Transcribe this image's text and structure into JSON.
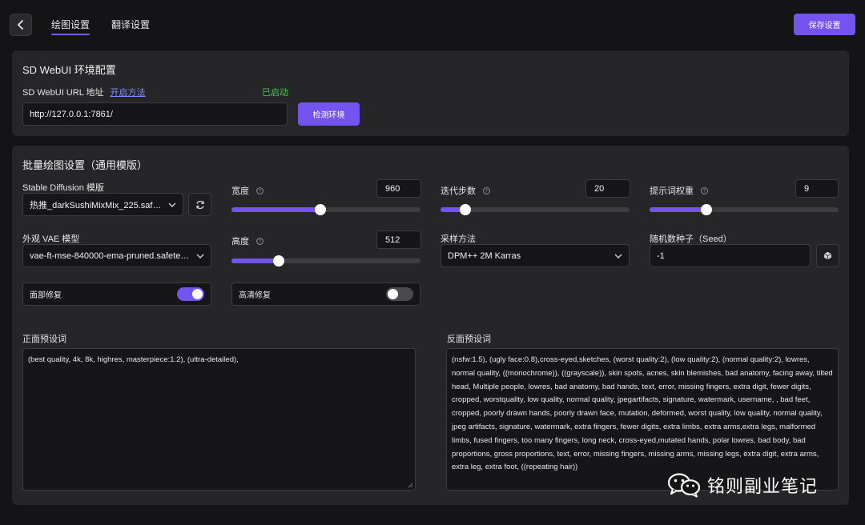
{
  "header": {
    "tabs": [
      {
        "label": "绘图设置",
        "active": true
      },
      {
        "label": "翻译设置",
        "active": false
      }
    ],
    "save_label": "保存设置"
  },
  "env": {
    "title": "SD WebUI 环境配置",
    "url_label": "SD WebUI URL 地址",
    "how_link": "开启方法",
    "status": "已启动",
    "url_value": "http://127.0.0.1:7861/",
    "detect_label": "检测环境"
  },
  "batch": {
    "title": "批量绘图设置（通用模版）",
    "model_label": "Stable Diffusion 模版",
    "model_value": "热推_darkSushiMixMix_225.safetensors",
    "vae_label": "外观 VAE 模型",
    "vae_value": "vae-ft-mse-840000-ema-pruned.safetensors",
    "width_label": "宽度",
    "width_value": "960",
    "width_fraction": 0.47,
    "height_label": "高度",
    "height_value": "512",
    "height_fraction": 0.25,
    "steps_label": "迭代步数",
    "steps_value": "20",
    "steps_fraction": 0.13,
    "cfg_label": "提示词权重",
    "cfg_value": "9",
    "cfg_fraction": 0.3,
    "sampler_label": "采样方法",
    "sampler_value": "DPM++ 2M Karras",
    "seed_label": "随机数种子（Seed）",
    "seed_value": "-1",
    "face_fix_label": "面部修复",
    "face_fix_on": true,
    "hires_label": "高清修复",
    "hires_on": false,
    "positive_label": "正面预设词",
    "positive_text": "(best quality, 4k, 8k, highres, masterpiece:1.2), (ultra-detailed),",
    "negative_label": "反面预设词",
    "negative_text": "(nsfw:1.5), (ugly face:0.8),cross-eyed,sketches, (worst quality:2), (low quality:2), (normal quality:2), lowres, normal quality, ((monochrome)), ((grayscale)), skin spots, acnes, skin blemishes, bad anatomy, facing away, tilted head, Multiple people, lowres, bad anatomy, bad hands, text, error, missing fingers, extra digit, fewer digits, cropped, worstquality, low quality, normal quality, jpegartifacts, signature, watermark, username, , bad feet, cropped, poorly drawn hands, poorly drawn face, mutation, deformed, worst quality, low quality, normal quality, jpeg artifacts, signature, watermark, extra fingers, fewer digits, extra limbs, extra arms,extra legs, malformed limbs, fused fingers, too many fingers, long neck, cross-eyed,mutated hands, polar lowres, bad body, bad proportions, gross proportions, text, error, missing fingers, missing arms, missing legs, extra digit, extra arms, extra leg, extra foot, ((repeating hair))"
  },
  "watermark": {
    "text": "铭则副业笔记"
  },
  "colors": {
    "accent": "#7354f0",
    "status_ok": "#3fcf4e",
    "link": "#7c8bff"
  }
}
